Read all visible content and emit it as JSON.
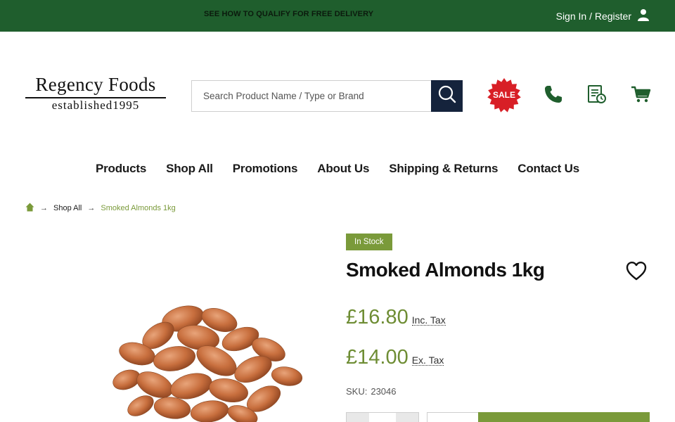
{
  "topbar": {
    "promo": "SEE HOW TO QUALIFY FOR FREE DELIVERY",
    "signin": "Sign In / Register",
    "color": "#1f5e2d"
  },
  "logo": {
    "line1": "Regency Foods",
    "line2": "established1995"
  },
  "search": {
    "placeholder": "Search Product Name / Type or Brand",
    "icon": "search-icon"
  },
  "header_icons": {
    "sale": "SALE",
    "sale_color": "#d81f26",
    "phone": "phone-icon",
    "order_history": "receipt-clock-icon",
    "cart": "cart-icon",
    "accent": "#1f5e2d"
  },
  "nav": {
    "items": [
      "Products",
      "Shop All",
      "Promotions",
      "About Us",
      "Shipping & Returns",
      "Contact Us"
    ]
  },
  "breadcrumb": {
    "home_icon": "home-icon",
    "items": [
      "Shop All",
      "Smoked Almonds 1kg"
    ]
  },
  "product": {
    "stock": "In Stock",
    "title": "Smoked Almonds 1kg",
    "price_inc": "£16.80",
    "price_inc_label": "Inc. Tax",
    "price_ex": "£14.00",
    "price_ex_label": "Ex. Tax",
    "sku_label": "SKU:",
    "sku": "23046",
    "price_color": "#6e8d34"
  }
}
